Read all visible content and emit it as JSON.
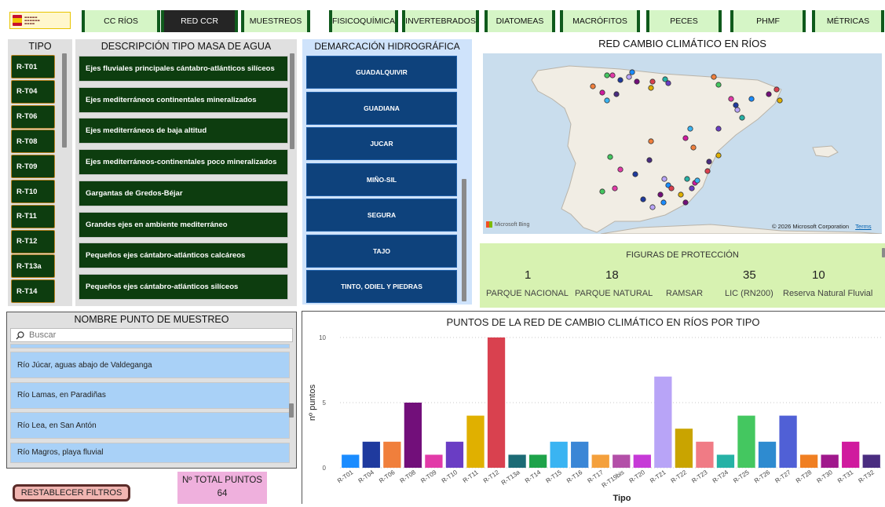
{
  "nav": {
    "tabs": [
      "CC RÍOS",
      "RED CCR",
      "MUESTREOS",
      "FISICOQUÍMICA",
      "INVERTEBRADOS",
      "DIATOMEAS",
      "MACRÓFITOS",
      "PECES",
      "PHMF",
      "MÉTRICAS"
    ],
    "active": "RED CCR"
  },
  "tipo": {
    "title": "TIPO",
    "items": [
      "R-T01",
      "R-T04",
      "R-T06",
      "R-T08",
      "R-T09",
      "R-T10",
      "R-T11",
      "R-T12",
      "R-T13a",
      "R-T14"
    ]
  },
  "descripcion": {
    "title": "DESCRIPCIÓN TIPO MASA DE AGUA",
    "items": [
      "Ejes fluviales principales cántabro-atlánticos silíceos",
      "Ejes mediterráneos continentales mineralizados",
      "Ejes mediterráneos de baja altitud",
      "Ejes mediterráneos-continentales poco mineralizados",
      "Gargantas de Gredos-Béjar",
      "Grandes ejes en ambiente mediterráneo",
      "Pequeños ejes cántabro-atlánticos calcáreos",
      "Pequeños ejes cántabro-atlánticos silíceos"
    ]
  },
  "demarcacion": {
    "title": "DEMARCACIÓN HIDROGRÁFICA",
    "items": [
      "GUADALQUIVIR",
      "GUADIANA",
      "JUCAR",
      "MIÑO-SIL",
      "SEGURA",
      "TAJO",
      "TINTO, ODIEL Y PIEDRAS"
    ]
  },
  "map": {
    "title": "RED CAMBIO CLIMÁTICO EN RÍOS",
    "provider": "Microsoft Bing",
    "copyright": "© 2026 Microsoft Corporation",
    "terms": "Terms"
  },
  "figuras": {
    "title": "FIGURAS DE PROTECCIÓN",
    "items": [
      {
        "value": "1",
        "label": "PARQUE NACIONAL"
      },
      {
        "value": "18",
        "label": "PARQUE NATURAL"
      },
      {
        "value": "",
        "label": "RAMSAR"
      },
      {
        "value": "35",
        "label": "LIC (RN200)"
      },
      {
        "value": "10",
        "label": "Reserva Natural Fluvial"
      }
    ]
  },
  "nombre": {
    "title": "NOMBRE PUNTO DE MUESTREO",
    "search_placeholder": "Buscar",
    "items": [
      "Río Júcar, aguas abajo de Valdeganga",
      "Río Lamas, en Paradiñas",
      "Río Lea, en San Antón",
      "Río Magros, playa fluvial"
    ]
  },
  "reset_label": "RESTABLECER FILTROS",
  "total": {
    "label": "Nº TOTAL PUNTOS",
    "value": "64"
  },
  "colors": {
    "green_dark": "#0d3d0f",
    "blue_dark": "#0e427c",
    "nav_bg": "#d5f5c6",
    "figuras_bg": "#d7f2b1"
  },
  "chart_data": {
    "type": "bar",
    "title": "PUNTOS DE LA RED DE CAMBIO CLIMÁTICO EN RÍOS POR TIPO",
    "xlabel": "Tipo",
    "ylabel": "nº puntos",
    "ylim": [
      0,
      10
    ],
    "yticks": [
      0,
      5,
      10
    ],
    "grid": true,
    "categories": [
      "R-T01",
      "R-T04",
      "R-T06",
      "R-T08",
      "R-T09",
      "R-T10",
      "R-T11",
      "R-T12",
      "R-T13a",
      "R-T14",
      "R-T15",
      "R-T16",
      "R-T17",
      "R-T19bis",
      "R-T20",
      "R-T21",
      "R-T22",
      "R-T23",
      "R-T24",
      "R-T25",
      "R-T26",
      "R-T27",
      "R-T28",
      "R-T30",
      "R-T31",
      "R-T32"
    ],
    "values": [
      1,
      2,
      2,
      5,
      1,
      2,
      4,
      10,
      1,
      1,
      2,
      2,
      1,
      1,
      1,
      7,
      3,
      2,
      1,
      4,
      2,
      4,
      1,
      1,
      2,
      1
    ],
    "colors": [
      "#1a8cff",
      "#1f3a9e",
      "#f07f3c",
      "#720f7a",
      "#e23aa8",
      "#6a3dc4",
      "#e0b000",
      "#d9414f",
      "#1c6b75",
      "#1ea34a",
      "#3ab4f2",
      "#3a86d6",
      "#f4a03c",
      "#b34fa8",
      "#c63ad7",
      "#b8a4f7",
      "#c9a400",
      "#f07b85",
      "#26b2a6",
      "#44c760",
      "#2e8bd0",
      "#5060d6",
      "#f07f22",
      "#a0188c",
      "#d01a9e",
      "#4a2d80"
    ]
  }
}
